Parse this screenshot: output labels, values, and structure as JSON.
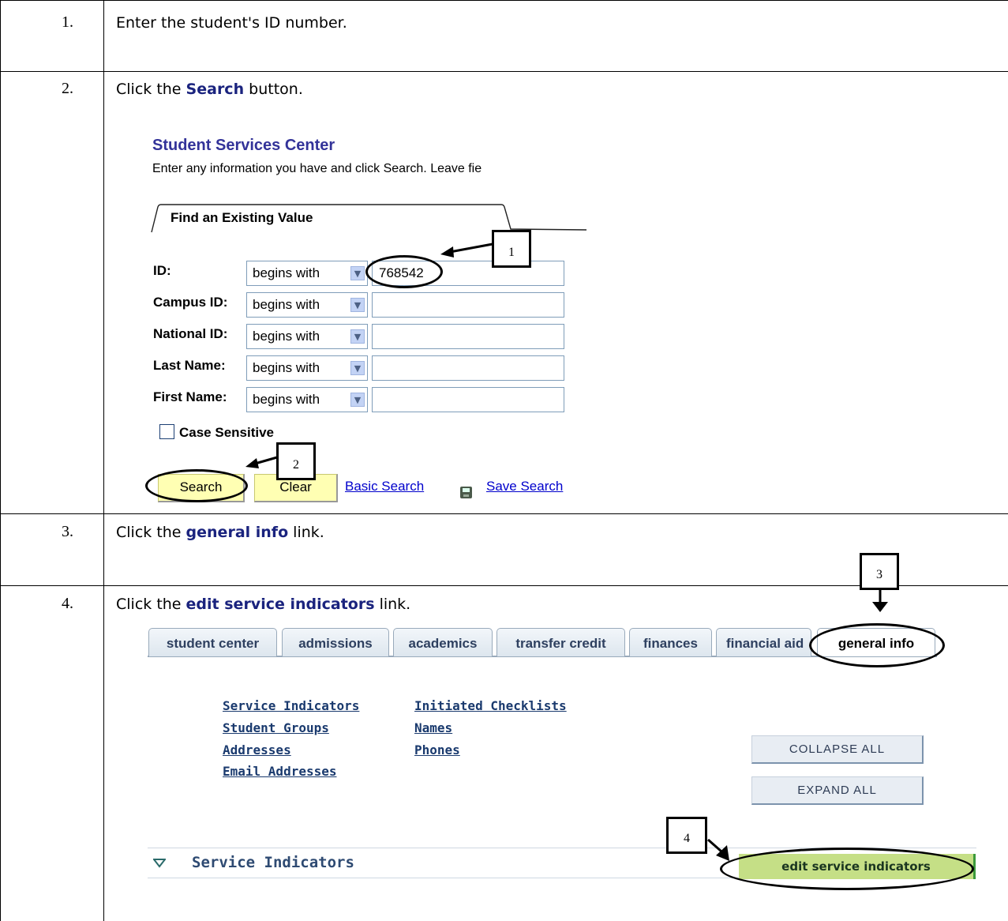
{
  "steps": [
    {
      "number": "1.",
      "pre": "Enter the student's ID number.",
      "highlight": "",
      "post": ""
    },
    {
      "number": "2.",
      "pre": "Click the ",
      "highlight": "Search",
      "post": " button."
    },
    {
      "number": "3.",
      "pre": "Click the ",
      "highlight": "general info",
      "post": " link."
    },
    {
      "number": "4.",
      "pre": "Click the ",
      "highlight": "edit service indicators",
      "post": " link."
    }
  ],
  "search_page": {
    "title": "Student Services Center",
    "instructions": "Enter any information you have and click Search. Leave fie",
    "tab_label": "Find an Existing Value",
    "operator": "begins with",
    "fields": [
      {
        "label": "ID:",
        "value": "768542"
      },
      {
        "label": "Campus ID:",
        "value": ""
      },
      {
        "label": "National ID:",
        "value": ""
      },
      {
        "label": "Last Name:",
        "value": ""
      },
      {
        "label": "First Name:",
        "value": ""
      }
    ],
    "case_sensitive_label": "Case Sensitive",
    "search_button": "Search",
    "clear_button": "Clear",
    "basic_search_link": "Basic Search",
    "save_search_link": "Save Search"
  },
  "student_center": {
    "tabs": [
      "student center",
      "admissions",
      "academics",
      "transfer credit",
      "finances",
      "financial aid",
      "general info"
    ],
    "links_col1": [
      "Service Indicators",
      "Student Groups",
      "Addresses",
      "Email Addresses"
    ],
    "links_col2": [
      "Initiated Checklists",
      "Names",
      "Phones"
    ],
    "collapse_all": "COLLAPSE ALL",
    "expand_all": "EXPAND ALL",
    "section_title": "Service Indicators",
    "edit_button": "edit service indicators"
  },
  "callouts": [
    "1",
    "2",
    "3",
    "4"
  ]
}
